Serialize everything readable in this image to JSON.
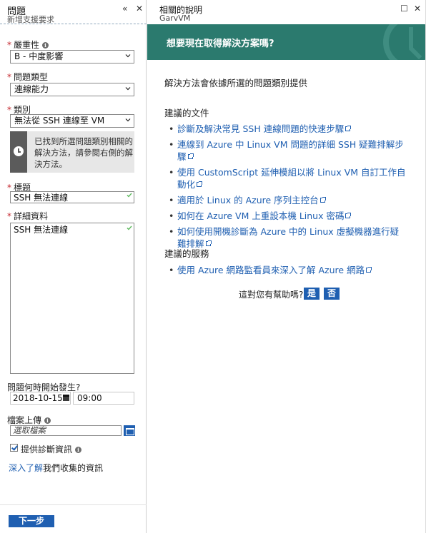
{
  "left_blade": {
    "title": "問題",
    "subtitle": "新增支援要求",
    "collapse_icon": "«",
    "close_icon": "✕",
    "severity": {
      "label": "嚴重性",
      "value": "B - 中度影響"
    },
    "problem_type": {
      "label": "問題類型",
      "value": "連線能力"
    },
    "category": {
      "label": "類別",
      "value": "無法從 SSH 連線至 VM"
    },
    "notice": "已找到所選問題類別相關的解決方法，請參閱右側的解決方法。",
    "title_field": {
      "label": "標題",
      "value": "SSH 無法連線"
    },
    "details": {
      "label": "詳細資料",
      "value": "SSH 無法連線"
    },
    "when": {
      "label": "問題何時開始發生?",
      "date": "2018-10-15",
      "time": "09:00"
    },
    "file_upload": {
      "label": "檔案上傳",
      "placeholder": "選取檔案"
    },
    "diagnostics_label": "提供診斷資訊",
    "learn_more_link": "深入了解",
    "learn_more_rest": "我們收集的資訊",
    "next_button": "下一步",
    "colors": {
      "required": "#c4262e",
      "accent": "#1f5fb1",
      "valid": "#5cb85c"
    }
  },
  "right_blade": {
    "title": "相關的說明",
    "subtitle": "GarvVM",
    "maximize_icon": "☐",
    "close_icon": "✕",
    "banner": "想要現在取得解決方案嗎?",
    "banner_color": "#2b7a6e",
    "intro": "解決方法會依據所選的問題類別提供",
    "docs_heading": "建議的文件",
    "docs": [
      "診斷及解決常見 SSH 連線問題的快速步驟",
      "連線到 Azure 中 Linux VM 問題的詳細 SSH 疑難排解步驟",
      "使用 CustomScript 延伸模組以將 Linux VM 自訂工作自動化",
      "適用於 Linux 的 Azure 序列主控台",
      "如何在 Azure VM 上重設本機 Linux 密碼",
      "如何使用開機診斷為 Azure 中的 Linux 虛擬機器進行疑難排解"
    ],
    "services_heading": "建議的服務",
    "services": [
      "使用 Azure 網路監看員來深入了解 Azure 網路"
    ],
    "feedback_question": "這對您有幫助嗎?",
    "yes": "是",
    "no": "否"
  }
}
